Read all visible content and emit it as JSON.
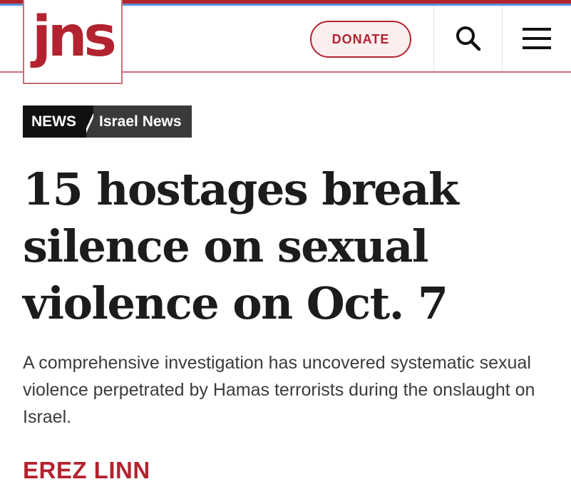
{
  "header": {
    "logo_text": "jns",
    "donate_label": "DONATE",
    "search_icon": "search-icon",
    "menu_icon": "hamburger-menu-icon"
  },
  "colors": {
    "brand_red": "#b3232f",
    "accent_blue": "#5a8fd8",
    "tag_dark": "#111111",
    "tag_gray": "#3a3a3a"
  },
  "category": {
    "section": "NEWS",
    "subsection": "Israel News"
  },
  "article": {
    "headline": "15 hostages break silence on sexual violence on Oct. 7",
    "dek": "A comprehensive investigation has uncovered systematic sexual violence perpetrated by Hamas terrorists during the onslaught on Israel.",
    "author": "EREZ LINN"
  }
}
